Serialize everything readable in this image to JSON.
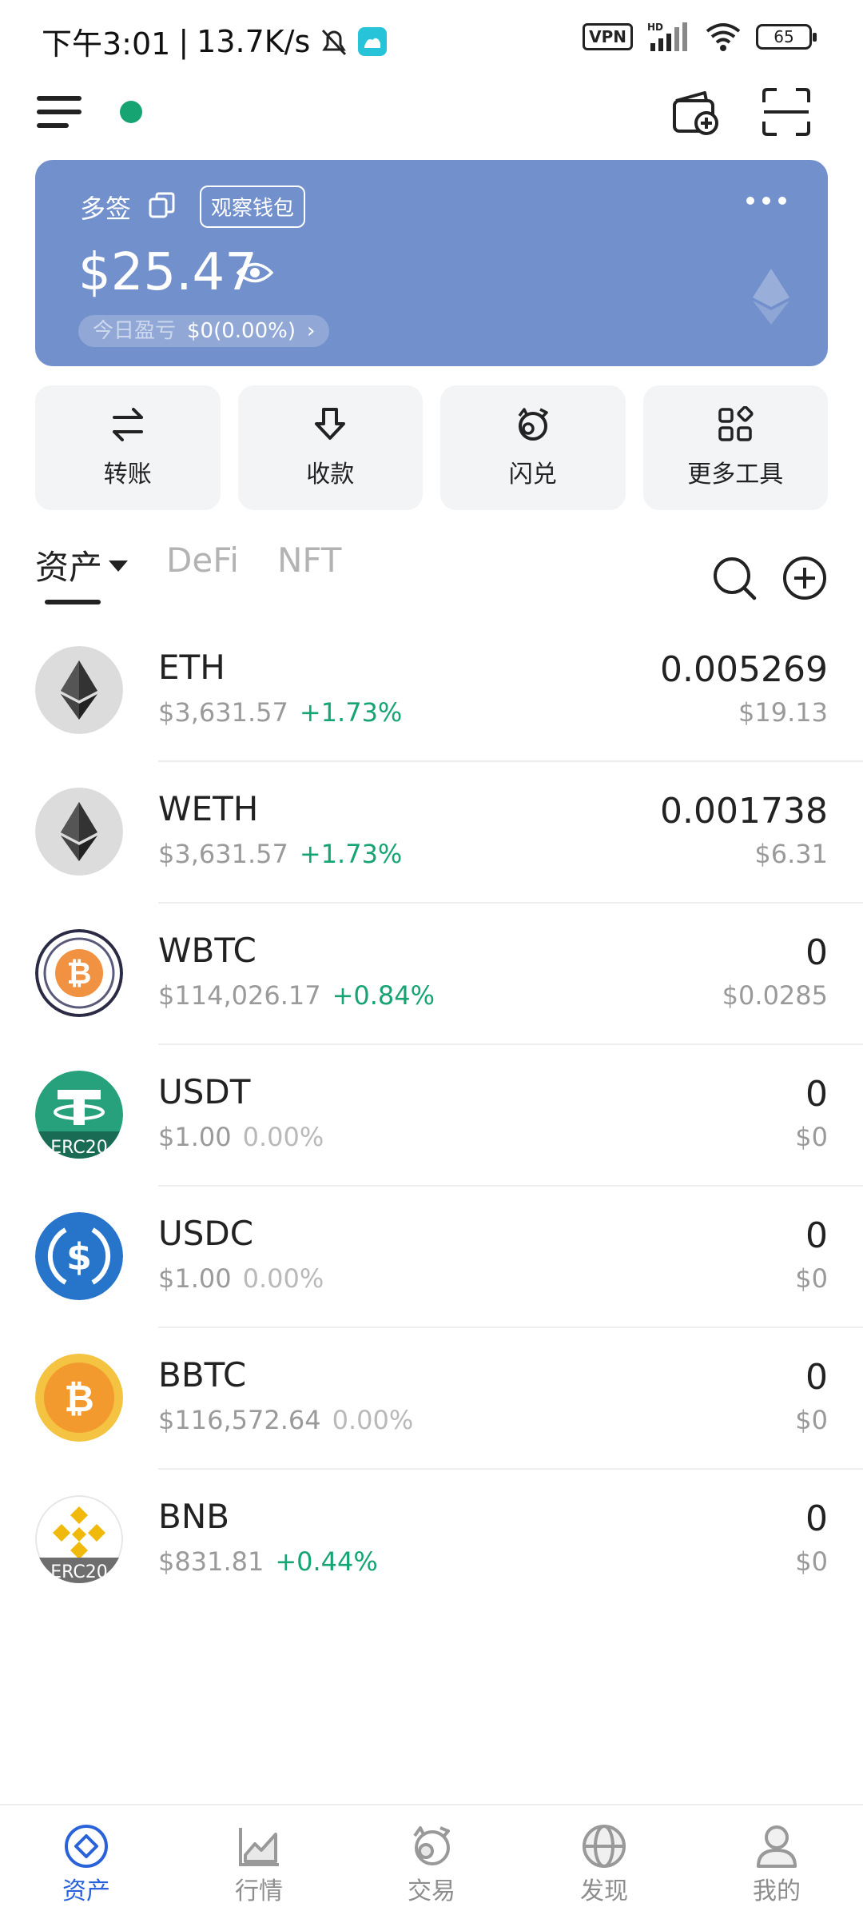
{
  "status_bar": {
    "time": "下午3:01",
    "net_speed": "13.7K/s",
    "vpn": "VPN",
    "hd": "HD",
    "battery": "65",
    "battery_level": 0.65
  },
  "header": {
    "online_indicator_color": "#16a572",
    "icons": [
      "menu-icon",
      "wallet-add-icon",
      "scan-icon"
    ]
  },
  "wallet_card": {
    "name": "多签",
    "badge": "观察钱包",
    "balance": "$25.47",
    "pnl_label": "今日盈亏",
    "pnl_value": "$0(0.00%)",
    "pnl_chevron": "›",
    "background_color": "#7290cc"
  },
  "actions": [
    {
      "label": "转账",
      "icon": "transfer-icon"
    },
    {
      "label": "收款",
      "icon": "receive-icon"
    },
    {
      "label": "闪兑",
      "icon": "swap-icon"
    },
    {
      "label": "更多工具",
      "icon": "more-tools-icon"
    }
  ],
  "tabs": [
    {
      "label": "资产",
      "active": true
    },
    {
      "label": "DeFi",
      "active": false
    },
    {
      "label": "NFT",
      "active": false
    }
  ],
  "assets": [
    {
      "symbol": "ETH",
      "price": "$3,631.57",
      "change": "+1.73%",
      "trend": "up",
      "amount": "0.005269",
      "value": "$19.13",
      "icon": "eth-icon"
    },
    {
      "symbol": "WETH",
      "price": "$3,631.57",
      "change": "+1.73%",
      "trend": "up",
      "amount": "0.001738",
      "value": "$6.31",
      "icon": "weth-icon"
    },
    {
      "symbol": "WBTC",
      "price": "$114,026.17",
      "change": "+0.84%",
      "trend": "up",
      "amount": "0",
      "value": "$0.0285",
      "icon": "wbtc-icon"
    },
    {
      "symbol": "USDT",
      "price": "$1.00",
      "change": "0.00%",
      "trend": "flat",
      "amount": "0",
      "value": "$0",
      "icon": "usdt-icon",
      "tag": "ERC20"
    },
    {
      "symbol": "USDC",
      "price": "$1.00",
      "change": "0.00%",
      "trend": "flat",
      "amount": "0",
      "value": "$0",
      "icon": "usdc-icon"
    },
    {
      "symbol": "BBTC",
      "price": "$116,572.64",
      "change": "0.00%",
      "trend": "flat",
      "amount": "0",
      "value": "$0",
      "icon": "bbtc-icon"
    },
    {
      "symbol": "BNB",
      "price": "$831.81",
      "change": "+0.44%",
      "trend": "up",
      "amount": "0",
      "value": "$0",
      "icon": "bnb-icon",
      "tag": "ERC20"
    }
  ],
  "bottom_nav": [
    {
      "label": "资产",
      "active": true,
      "icon": "assets-icon"
    },
    {
      "label": "行情",
      "active": false,
      "icon": "market-icon"
    },
    {
      "label": "交易",
      "active": false,
      "icon": "trade-icon"
    },
    {
      "label": "发现",
      "active": false,
      "icon": "discover-icon"
    },
    {
      "label": "我的",
      "active": false,
      "icon": "profile-icon"
    }
  ],
  "colors": {
    "up": "#16a572",
    "flat": "#b9b9b9",
    "nav_active": "#2a63d9"
  }
}
